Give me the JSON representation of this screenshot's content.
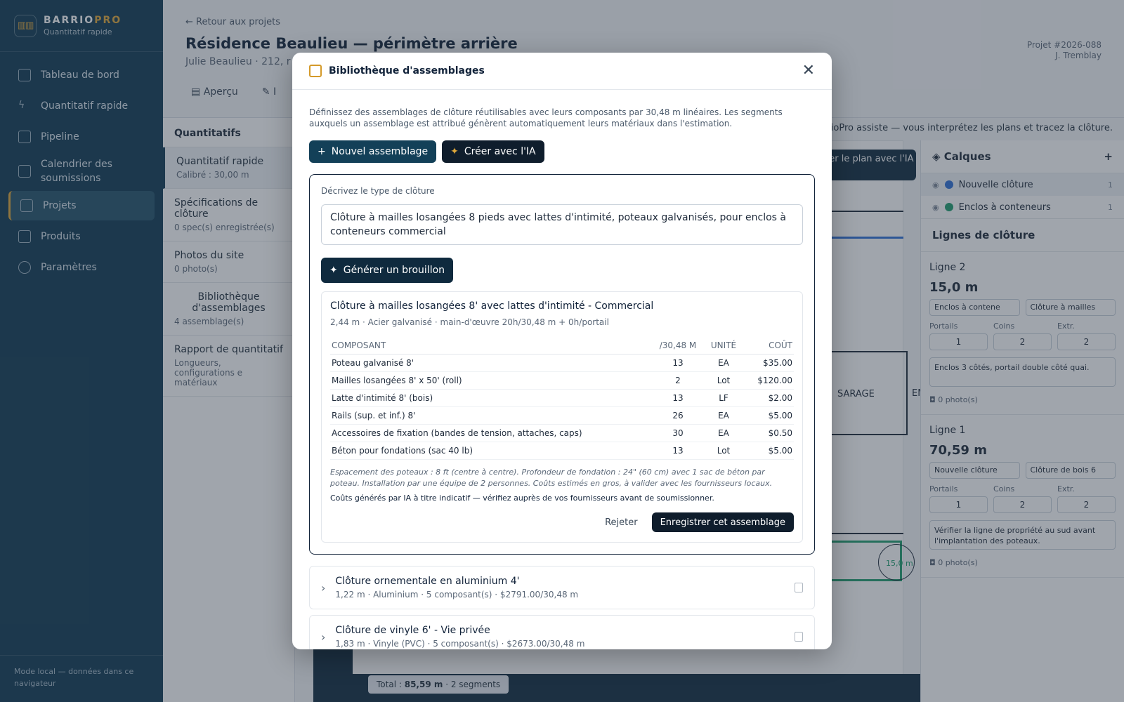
{
  "brand": {
    "name": "BARRIO",
    "name_accent": "PRO",
    "subtitle": "Quantitatif rapide"
  },
  "nav": [
    {
      "label": "Tableau de bord",
      "icon": "grid-icon"
    },
    {
      "label": "Quantitatif rapide",
      "icon": "lightning-icon"
    },
    {
      "label": "Pipeline",
      "icon": "folder-icon"
    },
    {
      "label": "Calendrier des soumissions",
      "icon": "calendar-icon"
    },
    {
      "label": "Projets",
      "icon": "folder-chart-icon"
    },
    {
      "label": "Produits",
      "icon": "box-icon"
    },
    {
      "label": "Paramètres",
      "icon": "gear-icon"
    }
  ],
  "sidebar_footer": "Mode local — données dans ce navigateur",
  "project": {
    "back": "Retour aux projets",
    "title": "Résidence Beaulieu — périmètre arrière",
    "subtitle": "Julie Beaulieu · 212, r",
    "number": "Projet #2026-088",
    "owner": "J. Tremblay",
    "tabs": [
      "Aperçu",
      "I"
    ]
  },
  "assist_text": "BarrioPro assiste — vous interprétez les plans et tracez la clôture.",
  "left_panel": {
    "title": "Quantitatifs",
    "items": [
      {
        "label": "Quantitatif rapide",
        "sub": "Calibré : 30,00 m"
      },
      {
        "label": "Spécifications de clôture",
        "sub": "0 spec(s) enregistrée(s)"
      },
      {
        "label": "Photos du site",
        "sub": "0 photo(s)"
      },
      {
        "label": "Bibliothèque d'assemblages",
        "sub": "4 assemblage(s)"
      },
      {
        "label": "Rapport de quantitatif",
        "sub": "Longueurs, configurations e matériaux"
      }
    ]
  },
  "canvas": {
    "ai_button": "ser le plan avec l'IA",
    "garage": "SARAGE",
    "en": "EN",
    "segment_label": "15,0 m",
    "total_label": "Total :",
    "total_value": "85,59 m",
    "total_segments": "· 2 segments"
  },
  "right_panel": {
    "layers_title": "Calques",
    "add": "+",
    "layers": [
      {
        "name": "Nouvelle clôture",
        "count": "1",
        "color": "#2f6fd6"
      },
      {
        "name": "Enclos à conteneurs",
        "count": "1",
        "color": "#1f9d6e"
      }
    ],
    "lines_title": "Lignes de clôture",
    "labels": {
      "portails": "Portails",
      "coins": "Coins",
      "extr": "Extr."
    },
    "lines": [
      {
        "name": "Ligne 2",
        "length": "15,0 m",
        "layer": "Enclos à contene",
        "type": "Clôture à mailles",
        "portails": "1",
        "coins": "2",
        "extr": "2",
        "note": "Enclos 3 côtés, portail double côté quai.",
        "photos": "0 photo(s)"
      },
      {
        "name": "Ligne 1",
        "length": "70,59 m",
        "layer": "Nouvelle clôture",
        "type": "Clôture de bois 6",
        "portails": "1",
        "coins": "2",
        "extr": "2",
        "note": "Vérifier la ligne de propriété au sud avant l'implantation des poteaux.",
        "photos": "0 photo(s)"
      }
    ]
  },
  "modal": {
    "title": "Bibliothèque d'assemblages",
    "description": "Définissez des assemblages de clôture réutilisables avec leurs composants par 30,48 m linéaires. Les segments auxquels un assemblage est attribué génèrent automatiquement leurs matériaux dans l'estimation.",
    "btn_new": "Nouvel assemblage",
    "btn_ai": "Créer avec l'IA",
    "ai_label": "Décrivez le type de clôture",
    "ai_prompt": "Clôture à mailles losangées 8 pieds avec lattes d'intimité, poteaux galvanisés, pour enclos à conteneurs commercial",
    "btn_generate": "Générer un brouillon",
    "draft": {
      "title": "Clôture à mailles losangées 8' avec lattes d'intimité - Commercial",
      "subtitle": "2,44 m · Acier galvanisé · main-d'œuvre 20h/30,48 m + 0h/portail",
      "headers": {
        "component": "COMPOSANT",
        "qty": "/30,48 M",
        "unit": "UNITÉ",
        "cost": "COÛT"
      },
      "rows": [
        {
          "name": "Poteau galvanisé 8'",
          "qty": "13",
          "unit": "EA",
          "cost": "$35.00"
        },
        {
          "name": "Mailles losangées 8' x 50' (roll)",
          "qty": "2",
          "unit": "Lot",
          "cost": "$120.00"
        },
        {
          "name": "Latte d'intimité 8' (bois)",
          "qty": "13",
          "unit": "LF",
          "cost": "$2.00"
        },
        {
          "name": "Rails (sup. et inf.) 8'",
          "qty": "26",
          "unit": "EA",
          "cost": "$5.00"
        },
        {
          "name": "Accessoires de fixation (bandes de tension, attaches, caps)",
          "qty": "30",
          "unit": "EA",
          "cost": "$0.50"
        },
        {
          "name": "Béton pour fondations (sac 40 lb)",
          "qty": "13",
          "unit": "Lot",
          "cost": "$5.00"
        }
      ],
      "notes": "Espacement des poteaux : 8 ft (centre à centre). Profondeur de fondation : 24\" (60 cm) avec 1 sac de béton par poteau. Installation par une équipe de 2 personnes. Coûts estimés en gros, à valider avec les fournisseurs locaux.",
      "disclaimer": "Coûts générés par IA à titre indicatif — vérifiez auprès de vos fournisseurs avant de soumissionner.",
      "reject": "Rejeter",
      "save": "Enregistrer cet assemblage"
    },
    "library": [
      {
        "name": "Clôture ornementale en aluminium 4'",
        "meta": "1,22 m · Aluminium · 5 composant(s) · $2791.00/30,48 m"
      },
      {
        "name": "Clôture de vinyle 6' - Vie privée",
        "meta": "1,83 m · Vinyle (PVC) · 5 composant(s) · $2673.00/30,48 m"
      }
    ]
  }
}
